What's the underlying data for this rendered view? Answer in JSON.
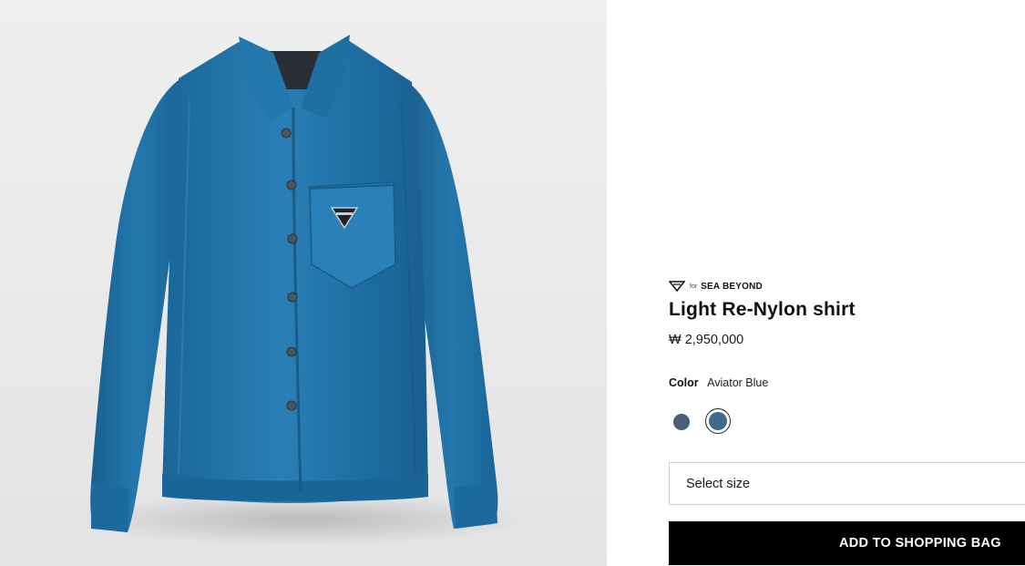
{
  "product": {
    "image_alt": "Light Re-Nylon shirt",
    "collaboration": {
      "prefix": "for",
      "name": "SEA BEYOND",
      "icon": "sea-beyond-triangle-icon"
    },
    "title": "Light Re-Nylon shirt",
    "price": "₩ 2,950,000"
  },
  "color": {
    "label": "Color",
    "selected": "Aviator Blue",
    "swatches": [
      {
        "name": "Navy",
        "hex": "#4b5d74",
        "selected": false
      },
      {
        "name": "Aviator Blue",
        "hex": "#3f6a8c",
        "selected": true
      }
    ]
  },
  "size": {
    "label": "Select size"
  },
  "actions": {
    "add_to_bag": "ADD TO SHOPPING BAG"
  },
  "theme": {
    "shirt": "#1e6ea3",
    "shirt_shadow": "#15577f",
    "shirt_highlight": "#3f95c9",
    "button_bg": "#000000"
  }
}
